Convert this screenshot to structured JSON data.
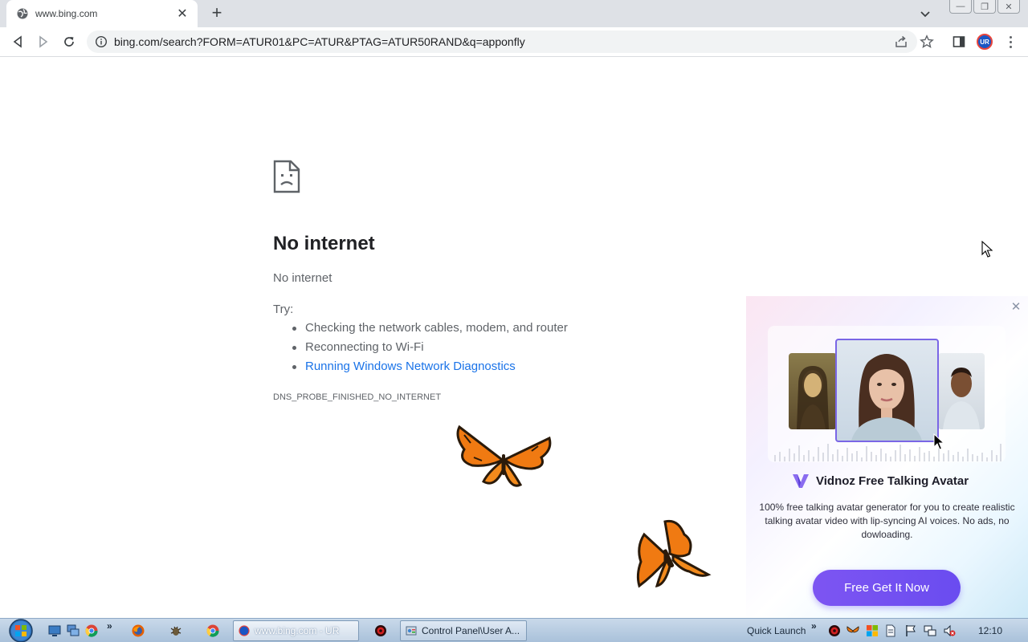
{
  "browser": {
    "tab": {
      "title": "www.bing.com",
      "close_glyph": "✕"
    },
    "new_tab_glyph": "+",
    "window_controls": {
      "minimize": "—",
      "restore": "❐",
      "close": "✕"
    },
    "omnibox": {
      "url": "bing.com/search?FORM=ATUR01&PC=ATUR&PTAG=ATUR50RAND&q=apponfly"
    },
    "profile_initials": "UR"
  },
  "error_page": {
    "heading": "No internet",
    "subheading": "No internet",
    "try_label": "Try:",
    "suggestions": [
      "Checking the network cables, modem, and router",
      "Reconnecting to Wi-Fi",
      "Running Windows Network Diagnostics"
    ],
    "error_code": "DNS_PROBE_FINISHED_NO_INTERNET"
  },
  "ad": {
    "close_glyph": "✕",
    "title": "Vidnoz Free Talking Avatar",
    "description": "100% free talking avatar generator for you to create realistic talking avatar video with lip-syncing AI voices. No ads, no dowloading.",
    "cta": "Free Get It Now"
  },
  "taskbar": {
    "chevron": "»",
    "tasks": [
      {
        "label": "www.bing.com - UR"
      },
      {
        "label": "Control Panel\\User A..."
      }
    ],
    "quick_launch": "Quick Launch",
    "clock": "12:10"
  },
  "colors": {
    "link": "#1a73e8",
    "ad_button": "#6a4cf0",
    "tabstrip": "#dee1e6",
    "butterfly": "#f07a12"
  }
}
